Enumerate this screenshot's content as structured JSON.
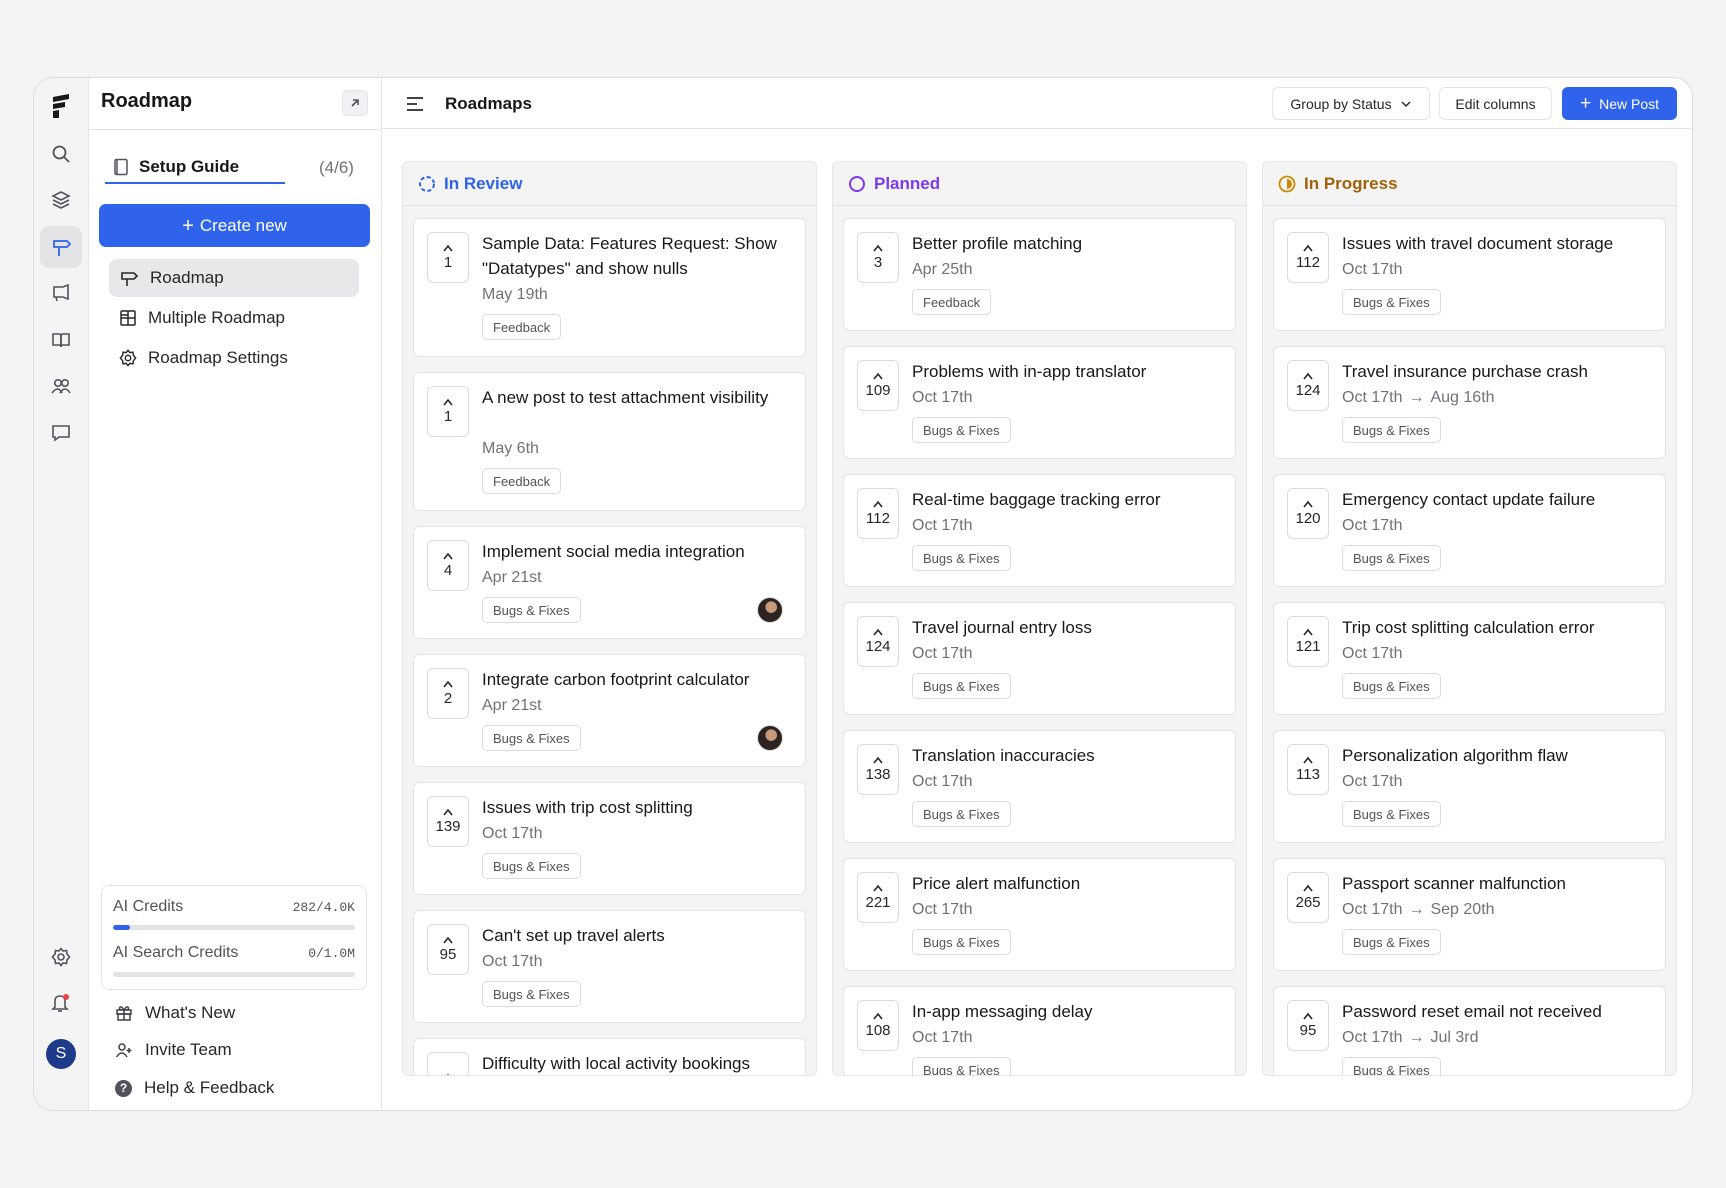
{
  "sidebar": {
    "title": "Roadmap",
    "setup_label": "Setup Guide",
    "setup_count": "(4/6)",
    "create_label": "Create new",
    "nav": [
      {
        "label": "Roadmap",
        "icon": "signpost-icon",
        "active": true
      },
      {
        "label": "Multiple Roadmap",
        "icon": "grid-icon",
        "active": false
      },
      {
        "label": "Roadmap Settings",
        "icon": "gear-icon",
        "active": false
      }
    ],
    "credits": [
      {
        "label": "AI Credits",
        "value": "282/4.0K",
        "fraction": 0.0705
      },
      {
        "label": "AI Search Credits",
        "value": "0/1.0M",
        "fraction": 0
      }
    ],
    "links": [
      {
        "label": "What's New",
        "icon": "gift-icon"
      },
      {
        "label": "Invite Team",
        "icon": "user-plus-icon"
      },
      {
        "label": "Help & Feedback",
        "icon": "help-icon"
      }
    ]
  },
  "rail": {
    "avatar_letter": "S",
    "icons": [
      "logo-icon",
      "search-icon",
      "layers-icon",
      "roadmap-icon",
      "megaphone-icon",
      "book-icon",
      "users-icon",
      "message-icon",
      "settings-icon",
      "bell-icon"
    ]
  },
  "header": {
    "title": "Roadmaps",
    "group_label": "Group by Status",
    "edit_label": "Edit columns",
    "new_post_label": "New Post"
  },
  "colors": {
    "accent": "#2f63ec",
    "in_review": "#2f63ec",
    "planned": "#7c3aed",
    "in_progress": "#a16207"
  },
  "columns": [
    {
      "name": "In Review",
      "color": "#2f63ec",
      "cards": [
        {
          "votes": "1",
          "title": "Sample Data: Features Request: Show \"Datatypes\" and show nulls",
          "date": "May 19th",
          "tag": "Feedback",
          "lines": 2,
          "avatar": false
        },
        {
          "votes": "1",
          "title": "A new post to test attachment visibility",
          "date": "May 6th",
          "tag": "Feedback",
          "lines": 2,
          "avatar": false
        },
        {
          "votes": "4",
          "title": "Implement social media integration",
          "date": "Apr 21st",
          "tag": "Bugs & Fixes",
          "lines": 1,
          "avatar": true
        },
        {
          "votes": "2",
          "title": "Integrate carbon footprint calculator",
          "date": "Apr 21st",
          "tag": "Bugs & Fixes",
          "lines": 1,
          "avatar": true
        },
        {
          "votes": "139",
          "title": "Issues with trip cost splitting",
          "date": "Oct 17th",
          "tag": "Bugs & Fixes",
          "lines": 1,
          "avatar": false
        },
        {
          "votes": "95",
          "title": "Can't set up travel alerts",
          "date": "Oct 17th",
          "tag": "Bugs & Fixes",
          "lines": 1,
          "avatar": false
        },
        {
          "votes": "",
          "title": "Difficulty with local activity bookings",
          "date": "",
          "tag": "",
          "lines": 1,
          "avatar": false
        }
      ]
    },
    {
      "name": "Planned",
      "color": "#7c3aed",
      "cards": [
        {
          "votes": "3",
          "title": "Better profile matching",
          "date": "Apr 25th",
          "tag": "Feedback",
          "lines": 1
        },
        {
          "votes": "109",
          "title": "Problems with in-app translator",
          "date": "Oct 17th",
          "tag": "Bugs & Fixes",
          "lines": 1
        },
        {
          "votes": "112",
          "title": "Real-time baggage tracking error",
          "date": "Oct 17th",
          "tag": "Bugs & Fixes",
          "lines": 1
        },
        {
          "votes": "124",
          "title": "Travel journal entry loss",
          "date": "Oct 17th",
          "tag": "Bugs & Fixes",
          "lines": 1
        },
        {
          "votes": "138",
          "title": "Translation inaccuracies",
          "date": "Oct 17th",
          "tag": "Bugs & Fixes",
          "lines": 1
        },
        {
          "votes": "221",
          "title": "Price alert malfunction",
          "date": "Oct 17th",
          "tag": "Bugs & Fixes",
          "lines": 1
        },
        {
          "votes": "108",
          "title": "In-app messaging delay",
          "date": "Oct 17th",
          "tag": "Bugs & Fixes",
          "lines": 1
        }
      ]
    },
    {
      "name": "In Progress",
      "color": "#a16207",
      "cards": [
        {
          "votes": "112",
          "title": "Issues with travel document storage",
          "date": "Oct 17th",
          "date_end": "",
          "tag": "Bugs & Fixes",
          "lines": 1
        },
        {
          "votes": "124",
          "title": "Travel insurance purchase crash",
          "date": "Oct 17th",
          "date_end": "Aug 16th",
          "tag": "Bugs & Fixes",
          "lines": 1
        },
        {
          "votes": "120",
          "title": "Emergency contact update failure",
          "date": "Oct 17th",
          "date_end": "",
          "tag": "Bugs & Fixes",
          "lines": 1
        },
        {
          "votes": "121",
          "title": "Trip cost splitting calculation error",
          "date": "Oct 17th",
          "date_end": "",
          "tag": "Bugs & Fixes",
          "lines": 1
        },
        {
          "votes": "113",
          "title": "Personalization algorithm flaw",
          "date": "Oct 17th",
          "date_end": "",
          "tag": "Bugs & Fixes",
          "lines": 1
        },
        {
          "votes": "265",
          "title": "Passport scanner malfunction",
          "date": "Oct 17th",
          "date_end": "Sep 20th",
          "tag": "Bugs & Fixes",
          "lines": 1
        },
        {
          "votes": "95",
          "title": "Password reset email not received",
          "date": "Oct 17th",
          "date_end": "Jul 3rd",
          "tag": "Bugs & Fixes",
          "lines": 1
        }
      ]
    }
  ]
}
